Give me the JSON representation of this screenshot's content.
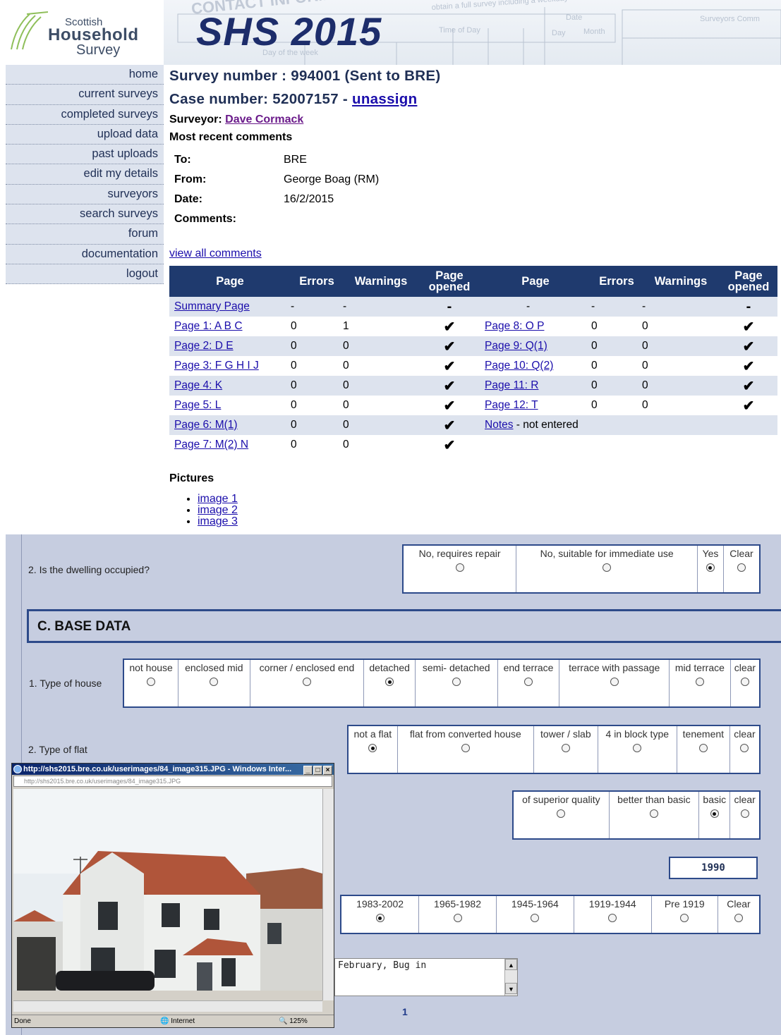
{
  "logo": {
    "line1": "Scottish",
    "line2": "Household",
    "line3": "Survey"
  },
  "banner": {
    "title": "SHS 2015",
    "bg_text": "CONTACT INFORMATION"
  },
  "nav": [
    {
      "label": "home"
    },
    {
      "label": "current surveys"
    },
    {
      "label": "completed surveys"
    },
    {
      "label": "upload data"
    },
    {
      "label": "past uploads"
    },
    {
      "label": "edit my details"
    },
    {
      "label": "surveyors"
    },
    {
      "label": "search surveys"
    },
    {
      "label": "forum"
    },
    {
      "label": "documentation"
    },
    {
      "label": "logout"
    }
  ],
  "survey": {
    "survey_line": "Survey number : 994001 (Sent to BRE)",
    "case_prefix": "Case number: 52007157 - ",
    "unassign": "unassign",
    "surveyor_label": "Surveyor: ",
    "surveyor_name": "Dave Cormack",
    "recent_title": "Most recent comments"
  },
  "comment": {
    "to_label": "To:",
    "to": "BRE",
    "from_label": "From:",
    "from": "George Boag (RM)",
    "date_label": "Date:",
    "date": "16/2/2015",
    "comments_label": "Comments:"
  },
  "view_all": "view all comments",
  "pages_table": {
    "headers": [
      "Page",
      "Errors",
      "Warnings",
      "Page opened",
      "Page",
      "Errors",
      "Warnings",
      "Page opened"
    ],
    "rows": [
      {
        "l_page": "Summary Page",
        "l_err": "-",
        "l_warn": "-",
        "l_open": "-",
        "r_page": "-",
        "r_err": "-",
        "r_warn": "-",
        "r_open": "-"
      },
      {
        "l_page": "Page 1: A B C",
        "l_err": "0",
        "l_warn": "1",
        "l_open": "✔",
        "r_page": "Page 8: O P",
        "r_err": "0",
        "r_warn": "0",
        "r_open": "✔"
      },
      {
        "l_page": "Page 2: D E",
        "l_err": "0",
        "l_warn": "0",
        "l_open": "✔",
        "r_page": "Page 9: Q(1)",
        "r_err": "0",
        "r_warn": "0",
        "r_open": "✔"
      },
      {
        "l_page": "Page 3: F G H I J",
        "l_err": "0",
        "l_warn": "0",
        "l_open": "✔",
        "r_page": "Page 10: Q(2)",
        "r_err": "0",
        "r_warn": "0",
        "r_open": "✔"
      },
      {
        "l_page": "Page 4: K",
        "l_err": "0",
        "l_warn": "0",
        "l_open": "✔",
        "r_page": "Page 11: R",
        "r_err": "0",
        "r_warn": "0",
        "r_open": "✔"
      },
      {
        "l_page": "Page 5: L",
        "l_err": "0",
        "l_warn": "0",
        "l_open": "✔",
        "r_page": "Page 12: T",
        "r_err": "0",
        "r_warn": "0",
        "r_open": "✔"
      },
      {
        "l_page": "Page 6: M(1)",
        "l_err": "0",
        "l_warn": "0",
        "l_open": "✔",
        "r_page": "Notes",
        "r_suffix": " - not entered"
      },
      {
        "l_page": "Page 7: M(2) N",
        "l_err": "0",
        "l_warn": "0",
        "l_open": "✔"
      }
    ]
  },
  "pictures": {
    "title": "Pictures",
    "items": [
      "image 1",
      "image 2",
      "image 3"
    ]
  },
  "form": {
    "q_occupied": "2. Is the dwelling occupied?",
    "occupied_options": [
      "No, requires repair",
      "No, suitable for immediate use",
      "Yes",
      "Clear"
    ],
    "occupied_selected": 2,
    "section_c": "C. BASE DATA",
    "q_house": "1. Type of house",
    "house_options": [
      "not house",
      "enclosed mid",
      "corner / enclosed end",
      "detached",
      "semi- detached",
      "end terrace",
      "terrace with passage",
      "mid terrace",
      "clear"
    ],
    "house_selected": 3,
    "q_flat": "2. Type of flat",
    "flat_options": [
      "not a flat",
      "flat from converted house",
      "tower / slab",
      "4 in block type",
      "tenement",
      "clear"
    ],
    "flat_selected": 0,
    "quality_options": [
      "of superior quality",
      "better than basic",
      "basic",
      "clear"
    ],
    "quality_selected": 2,
    "year_value": "1990",
    "age_options": [
      "1983-2002",
      "1965-1982",
      "1945-1964",
      "1919-1944",
      "Pre 1919",
      "Clear"
    ],
    "age_selected": 0,
    "comments_text": "February, Bug in",
    "page_number": "1"
  },
  "popup": {
    "title": "http://shs2015.bre.co.uk/userimages/84_image315.JPG - Windows Inter...",
    "address": "http://shs2015.bre.co.uk/userimages/84_image315.JPG",
    "status": "Done",
    "zone": "Internet",
    "zoom": "125%"
  },
  "colors": {
    "nav_bg": "#dde3ee",
    "table_header": "#1f3a6e",
    "heading": "#1f2f55",
    "form_bg": "#c6cde0",
    "form_border": "#2d4a8a"
  }
}
